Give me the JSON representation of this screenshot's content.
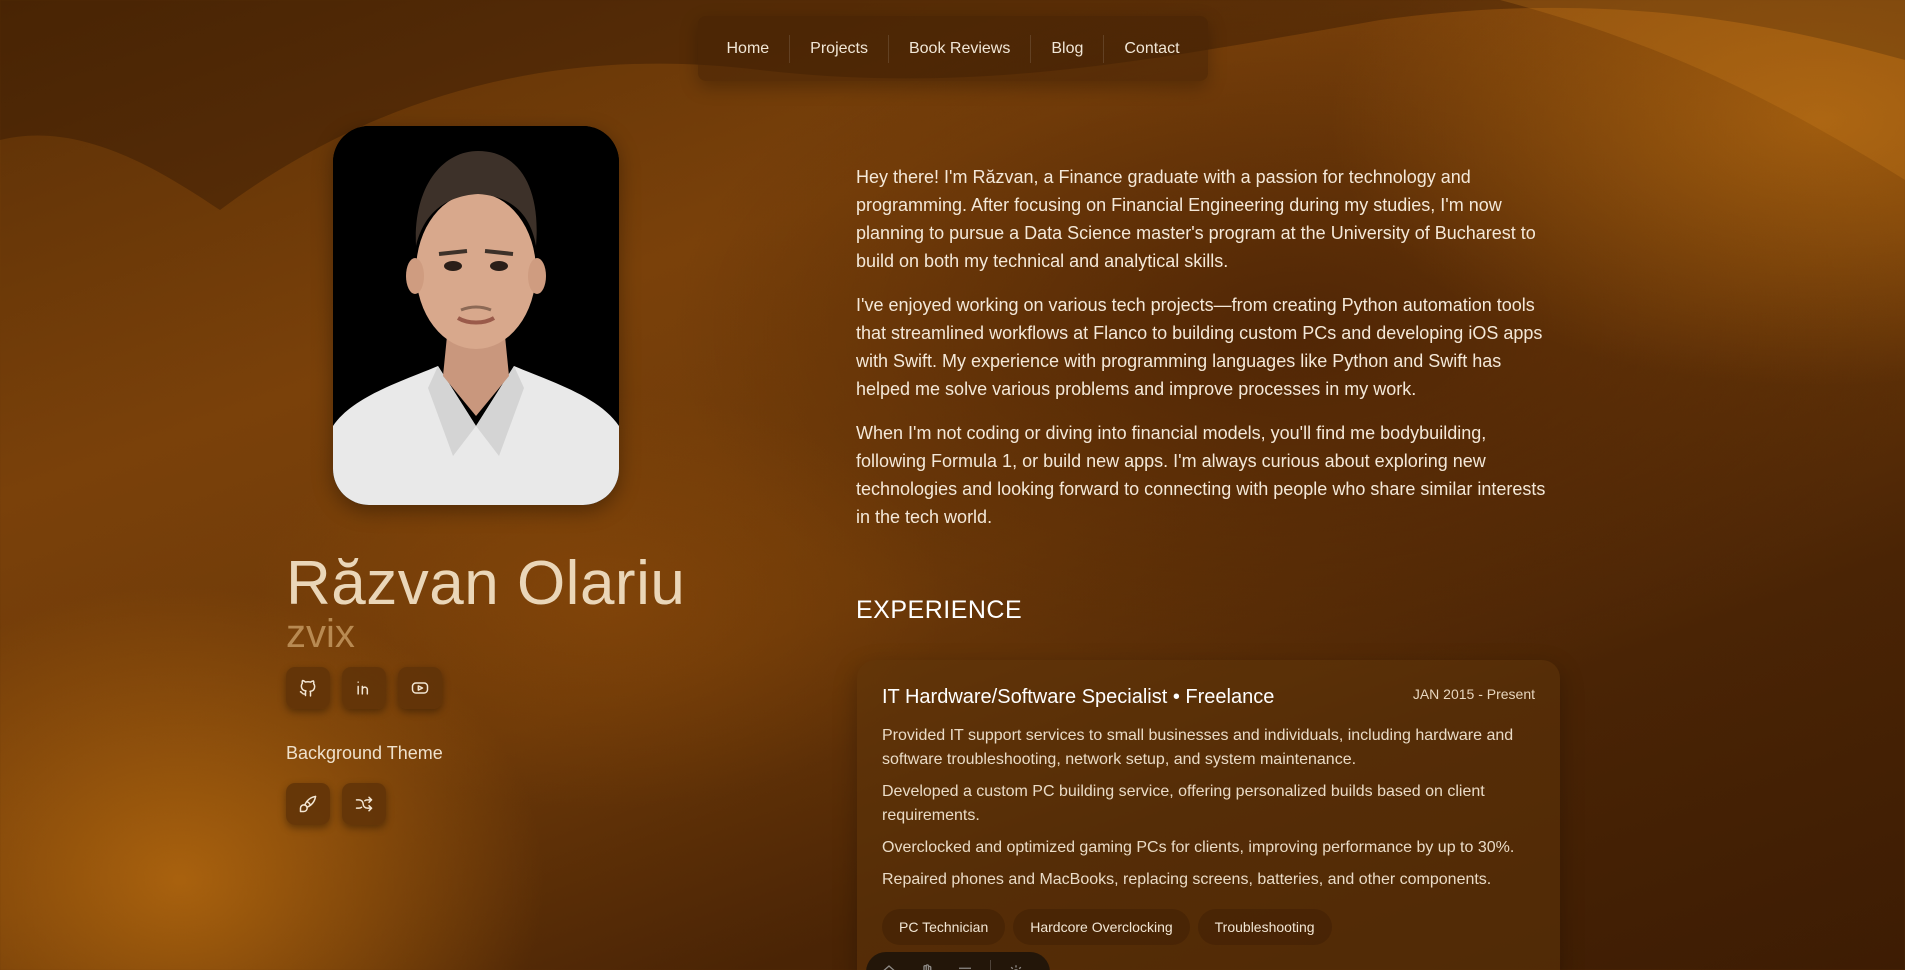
{
  "nav": {
    "items": [
      "Home",
      "Projects",
      "Book Reviews",
      "Blog",
      "Contact"
    ]
  },
  "profile": {
    "name": "Răzvan Olariu",
    "alias": "zvix",
    "socials": [
      {
        "icon": "github-icon"
      },
      {
        "icon": "linkedin-icon"
      },
      {
        "icon": "youtube-icon"
      }
    ],
    "background_theme_label": "Background Theme",
    "theme_buttons": [
      {
        "icon": "paint-brush-icon"
      },
      {
        "icon": "shuffle-icon"
      }
    ]
  },
  "about": {
    "paragraphs": [
      "Hey there! I'm Răzvan, a Finance graduate with a passion for technology and programming. After focusing on Financial Engineering during my studies, I'm now planning to pursue a Data Science master's program at the University of Bucharest to build on both my technical and analytical skills.",
      "I've enjoyed working on various tech projects—from creating Python automation tools that streamlined workflows at Flanco to building custom PCs and developing iOS apps with Swift. My experience with programming languages like Python and Swift has helped me solve various problems and improve processes in my work.",
      "When I'm not coding or diving into financial models, you'll find me bodybuilding, following Formula 1, or build new apps. I'm always curious about exploring new technologies and looking forward to connecting with people who share similar interests in the tech world."
    ]
  },
  "experience": {
    "heading": "EXPERIENCE",
    "jobs": [
      {
        "title": "IT Hardware/Software Specialist • Freelance",
        "date": "JAN 2015 - Present",
        "bullets": [
          "Provided IT support services to small businesses and individuals, including hardware and software troubleshooting, network setup, and system maintenance.",
          "Developed a custom PC building service, offering personalized builds based on client requirements.",
          "Overclocked and optimized gaming PCs for clients, improving performance by up to 30%.",
          "Repaired phones and MacBooks, replacing screens, batteries, and other components."
        ],
        "tags": [
          "PC Technician",
          "Hardcore Overclocking",
          "Troubleshooting"
        ]
      }
    ]
  },
  "colors": {
    "accent": "#b88a52",
    "name_color": "#ead6b8"
  }
}
